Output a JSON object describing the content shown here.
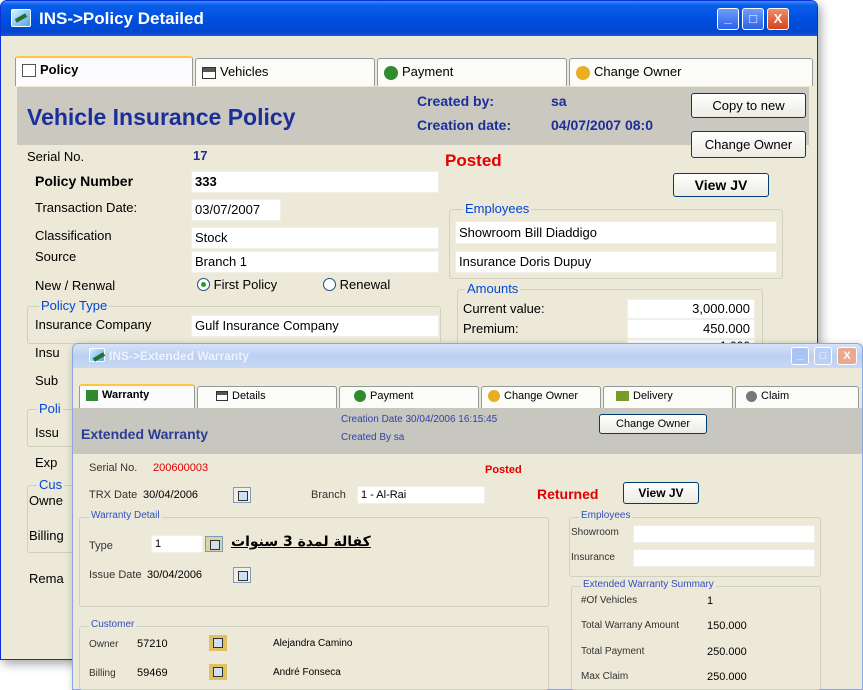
{
  "policy_window": {
    "title": "INS->Policy Detailed",
    "buttons": {
      "minimize": "_",
      "maximize": "□",
      "close": "X"
    },
    "tabs": [
      {
        "label": "Policy",
        "icon": "policy-icon"
      },
      {
        "label": "Vehicles",
        "icon": "vehicles-icon"
      },
      {
        "label": "Payment",
        "icon": "money-bag-icon"
      },
      {
        "label": "Change Owner",
        "icon": "person-icon"
      }
    ],
    "header": {
      "title": "Vehicle Insurance Policy",
      "created_by_label": "Created by:",
      "created_by_value": "sa",
      "creation_date_label": "Creation date:",
      "creation_date_value": "04/07/2007 08:0",
      "copy_button": "Copy to new",
      "change_owner_button": "Change Owner"
    },
    "fields": {
      "serial_label": "Serial No.",
      "serial_value": "17",
      "status": "Posted",
      "policy_number_label": "Policy Number",
      "policy_number_value": "333",
      "transaction_date_label": "Transaction Date:",
      "transaction_date_value": "03/07/2007",
      "classification_label": "Classification",
      "classification_value": "Stock",
      "source_label": "Source",
      "source_value": "Branch 1",
      "new_renewal_label": "New / Renwal",
      "first_policy_label": "First Policy",
      "renewal_label": "Renewal",
      "view_jv_button": "View JV"
    },
    "employees": {
      "legend": "Employees",
      "showroom": "Showroom Bill Diaddigo",
      "insurance": "Insurance  Doris Dupuy"
    },
    "amounts": {
      "legend": "Amounts",
      "current_value_label": "Current value:",
      "current_value": "3,000.000",
      "premium_label": "Premium:",
      "premium": "450.000",
      "partial_value": "1,000"
    },
    "policy_type": {
      "legend": "Policy Type",
      "insurance_company_label": "Insurance Company",
      "insurance_company_value": "Gulf Insurance Company",
      "insu_cut": "Insu",
      "sub_cut": "Sub"
    },
    "cut_labels": {
      "poli": "Poli",
      "issu": "Issu",
      "exp": "Exp",
      "cus": "Cus",
      "owne": "Owne",
      "billing": "Billing",
      "rema": "Rema"
    }
  },
  "warranty_window": {
    "title": "INS->Extended Warranty",
    "buttons": {
      "minimize": "_",
      "maximize": "□",
      "close": "X"
    },
    "tabs": [
      {
        "label": "Warranty",
        "icon": "warranty-icon"
      },
      {
        "label": "Details",
        "icon": "details-icon"
      },
      {
        "label": "Payment",
        "icon": "money-bag-icon"
      },
      {
        "label": "Change Owner",
        "icon": "person-icon"
      },
      {
        "label": "Delivery",
        "icon": "delivery-icon"
      },
      {
        "label": "Claim",
        "icon": "claim-icon"
      }
    ],
    "header": {
      "title": "Extended Warranty",
      "creation_date": "Creation Date 30/04/2006 16:15:45",
      "created_by": "Created By   sa",
      "change_owner_button": "Change Owner"
    },
    "fields": {
      "serial_label": "Serial No.",
      "serial_value": "200600003",
      "posted": "Posted",
      "trx_date_label": "TRX Date",
      "trx_date_value": "30/04/2006",
      "branch_label": "Branch",
      "branch_value": "1 - Al-Rai",
      "returned": "Returned",
      "view_jv_button": "View JV"
    },
    "warranty_detail": {
      "legend": "Warranty Detail",
      "type_label": "Type",
      "type_value": "1",
      "type_description": "كفالة لمدة 3 سنوات",
      "issue_date_label": "Issue Date",
      "issue_date_value": "30/04/2006"
    },
    "employees": {
      "legend": "Employees",
      "showroom_label": "Showroom",
      "insurance_label": "Insurance"
    },
    "summary": {
      "legend": "Extended Warranty Summary",
      "vehicles_label": "#Of Vehicles",
      "vehicles_value": "1",
      "total_warranty_label": "Total Warrany Amount",
      "total_warranty_value": "150.000",
      "total_payment_label": "Total Payment",
      "total_payment_value": "250.000",
      "max_claim_label": "Max Claim",
      "max_claim_value": "250.000"
    },
    "customer": {
      "legend": "Customer",
      "owner_label": "Owner",
      "owner_code": "57210",
      "owner_name": "Alejandra Camino",
      "billing_label": "Billing",
      "billing_code": "59469",
      "billing_name": "André Fonseca"
    }
  }
}
